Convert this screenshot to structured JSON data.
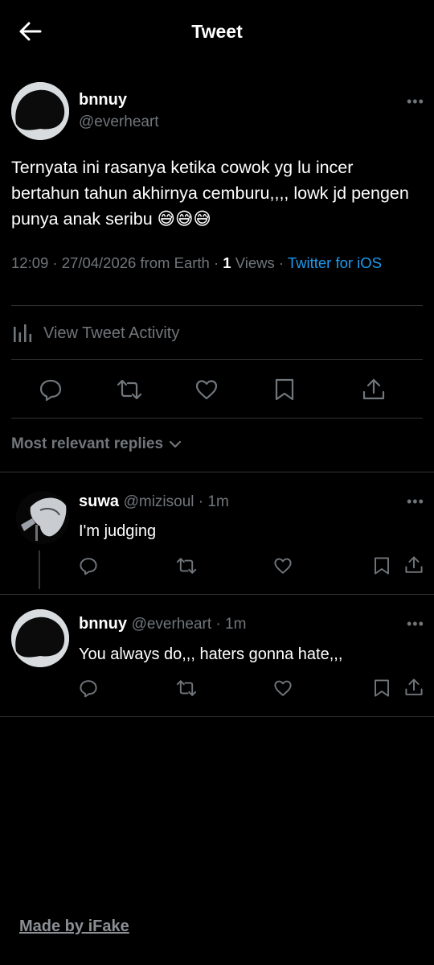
{
  "header": {
    "title": "Tweet"
  },
  "tweet": {
    "author_name": "bnnuy",
    "author_handle": "@everheart",
    "text": "Ternyata ini rasanya ketika cowok yg lu incer bertahun tahun akhirnya cemburu,,,, lowk jd pengen punya anak seribu 😅😅😅",
    "time": "12:09 · 27/04/2026 from Earth · ",
    "views_count": "1",
    "views_label": " Views · ",
    "source": "Twitter for iOS"
  },
  "activity": {
    "label": "View Tweet Activity"
  },
  "sort": {
    "label": "Most relevant replies"
  },
  "replies": [
    {
      "name": "suwa",
      "handle": "@mizisoul · 1m",
      "text": "I'm judging"
    },
    {
      "name": "bnnuy",
      "handle": "@everheart · 1m",
      "text": "You always do,,, haters gonna hate,,,"
    }
  ],
  "more_glyph": "•••",
  "footer": {
    "label": "Made by iFake"
  },
  "colors": {
    "background": "#000000",
    "text": "#e7e9ea",
    "muted": "#71767b",
    "link": "#1d9bf0",
    "divider": "#2f3336"
  }
}
